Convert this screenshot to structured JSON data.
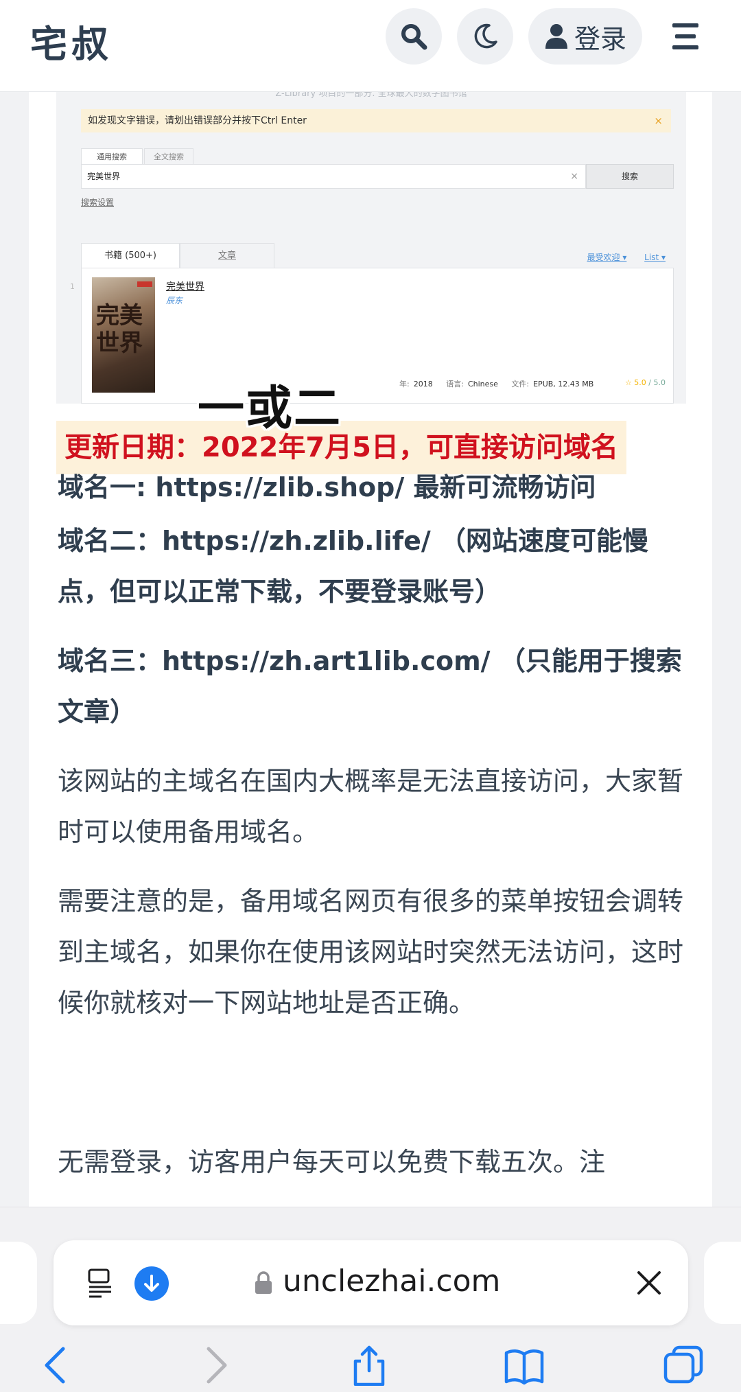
{
  "header": {
    "logo": "宅叔",
    "login_label": "登录",
    "icons": [
      "search-icon",
      "moon-icon",
      "user-icon",
      "menu-icon"
    ]
  },
  "embedded_screenshot": {
    "faded_top_text": "Z-Library 项目的一部分. 全球最大的数字图书馆",
    "notice": "如发现文字错误，请划出错误部分并按下Ctrl Enter",
    "notice_close": "×",
    "search_tabs": [
      "通用搜索",
      "全文搜索"
    ],
    "search_value": "完美世界",
    "search_clear": "×",
    "search_button": "搜索",
    "search_settings": "搜索设置",
    "result_tabs": [
      "书籍 (500+)",
      "文章"
    ],
    "sort_links": [
      "最受欢迎 ▾",
      "List ▾"
    ],
    "row_number": "1",
    "cover_text": "完美世界",
    "book_title": "完美世界",
    "book_author": "辰东",
    "meta": {
      "year_label": "年:",
      "year": "2018",
      "lang_label": "语言:",
      "lang": "Chinese",
      "file_label": "文件:",
      "file": "EPUB, 12.43 MB"
    },
    "rating": "☆ 5.0",
    "rating_max": "/ 5.0"
  },
  "overlay_caption": "一或二",
  "article": {
    "update_banner": "更新日期：2022年7月5日，可直接访问域名",
    "domain1": "域名一: https://zlib.shop/     最新可流畅访问",
    "domain2": "域名二：https://zh.zlib.life/     （网站速度可能慢点，但可以正常下载，不要登录账号）",
    "domain3": "域名三：https://zh.art1lib.com/ （只能用于搜索文章）",
    "para1": "该网站的主域名在国内大概率是无法直接访问，大家暂时可以使用备用域名。",
    "para2": "需要注意的是，备用域名网页有很多的菜单按钮会调转到主域名，如果你在使用该网站时突然无法访问，这时候你就核对一下网站地址是否正确。",
    "para3": "无需登录，访客用户每天可以免费下载五次。注"
  },
  "browser": {
    "url": "unclezhai.com",
    "icons": [
      "reader-icon",
      "download-icon",
      "lock-icon",
      "close-icon",
      "back-icon",
      "forward-icon",
      "share-icon",
      "bookmarks-icon",
      "tabs-icon"
    ],
    "accent": "#1e7cf2"
  }
}
